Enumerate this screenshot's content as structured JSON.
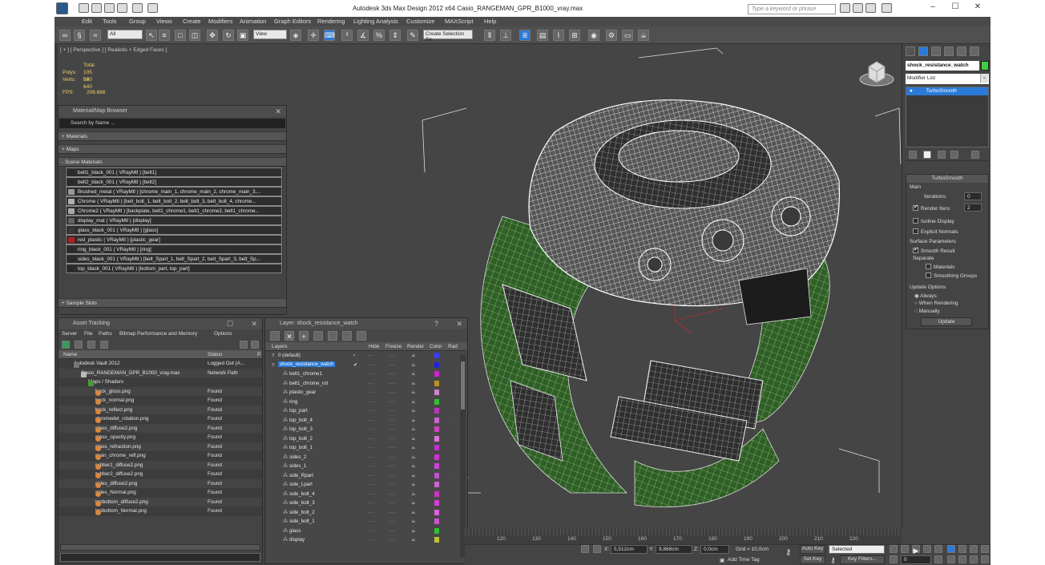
{
  "window": {
    "title": "Autodesk 3ds Max Design 2012 x64     Casio_RANGEMAN_GPR_B1000_vray.max",
    "search_placeholder": "Type a keyword or phrase",
    "min": "–",
    "max": "☐",
    "close": "✕"
  },
  "menu": [
    "Edit",
    "Tools",
    "Group",
    "Views",
    "Create",
    "Modifiers",
    "Animation",
    "Graph Editors",
    "Rendering",
    "Lighting Analysis",
    "Customize",
    "MAXScript",
    "Help"
  ],
  "toolbar": {
    "selection_filter": "All",
    "ref_coord": "View",
    "selection_set": "Create Selection Se"
  },
  "viewport": {
    "label": "[ + ] [ Perspective ] [ Realistic + Edged Faces ]",
    "stats_total": "Total",
    "polys_label": "Polys:",
    "polys": "105 040",
    "verts_label": "Verts:",
    "verts": "53 640",
    "fps_label": "FPS:",
    "fps": "206.686"
  },
  "material_browser": {
    "title": "Material/Map Browser",
    "search": "Search by Name ...",
    "sections": {
      "materials": "+ Materials",
      "maps": "+ Maps",
      "scene": "- Scene Materials",
      "samples": "+ Sample Slots"
    },
    "items": [
      {
        "label": "belt1_black_001  ( VRayMtl )  [belt1]",
        "color": "#2a2a2a"
      },
      {
        "label": "belt2_black_001  ( VRayMtl )  [belt2]",
        "color": "#2a2a2a"
      },
      {
        "label": "Brushed_metal  ( VRayMtl )  [chrome_main_1, chrome_main_2, chrome_main_3,...",
        "color": "#9a9a9a"
      },
      {
        "label": "Chrome  ( VRayMtl )  [belt_bolt_1, belt_bolt_2, belt_bolt_3, belt_bolt_4, chrome...",
        "color": "#b0b0b0"
      },
      {
        "label": "Chrome2  ( VRayMtl )  [backplate, belt1_chrome1, belt1_chrome2, belt1_chrome...",
        "color": "#a8a8a8"
      },
      {
        "label": "display_mat  ( VRayMtl )  [display]",
        "color": "#606060"
      },
      {
        "label": "glass_black_001  ( VRayMtl )  [glass]",
        "color": "#3a3a3a"
      },
      {
        "label": "red_plastic  ( VRayMtl )  [plastic_gear]",
        "color": "#b02020"
      },
      {
        "label": "ring_black_001  ( VRayMtl )  [ring]",
        "color": "#2a2a2a"
      },
      {
        "label": "sides_black_001  ( VRayMtl )  [belt_Spart_1, belt_Spart_2, belt_Spart_3, belt_Sp...",
        "color": "#2a2a2a"
      },
      {
        "label": "top_black_001  ( VRayMtl )  [bottom_part, top_part]",
        "color": "#2a2a2a"
      }
    ]
  },
  "asset_tracking": {
    "title": "Asset Tracking",
    "menu": [
      "Server",
      "File",
      "Paths",
      "Bitmap Performance and Memory",
      "Options"
    ],
    "col_name": "Name",
    "col_status": "Status",
    "col_p": "P",
    "rows": [
      {
        "name": "Autodesk Vault 2012",
        "status": "Logged Out (A...",
        "indent": 1,
        "kind": "vault"
      },
      {
        "name": "Casio_RANGEMAN_GPR_B1000_vray.max",
        "status": "Network Path",
        "indent": 2,
        "kind": "file"
      },
      {
        "name": "Maps / Shaders",
        "status": "",
        "indent": 3,
        "kind": "folder"
      },
      {
        "name": "back_gloss.png",
        "status": "Found",
        "indent": 4,
        "kind": "map"
      },
      {
        "name": "back_normal.png",
        "status": "Found",
        "indent": 4,
        "kind": "map"
      },
      {
        "name": "back_reflect.png",
        "status": "Found",
        "indent": 4,
        "kind": "map"
      },
      {
        "name": "chromedet_rotation.png",
        "status": "Found",
        "indent": 4,
        "kind": "map"
      },
      {
        "name": "glass_diffuse2.png",
        "status": "Found",
        "indent": 4,
        "kind": "map"
      },
      {
        "name": "glass_opacity.png",
        "status": "Found",
        "indent": 4,
        "kind": "map"
      },
      {
        "name": "glass_refraction.png",
        "status": "Found",
        "indent": 4,
        "kind": "map"
      },
      {
        "name": "main_chrome_refl.png",
        "status": "Found",
        "indent": 4,
        "kind": "map"
      },
      {
        "name": "rubber1_diffuse2.png",
        "status": "Found",
        "indent": 4,
        "kind": "map"
      },
      {
        "name": "rubber2_diffuse2.png",
        "status": "Found",
        "indent": 4,
        "kind": "map"
      },
      {
        "name": "sides_diffuse2.png",
        "status": "Found",
        "indent": 4,
        "kind": "map"
      },
      {
        "name": "sides_Normal.png",
        "status": "Found",
        "indent": 4,
        "kind": "map"
      },
      {
        "name": "topbottom_diffuse2.png",
        "status": "Found",
        "indent": 4,
        "kind": "map"
      },
      {
        "name": "topbottom_Normal.png",
        "status": "Found",
        "indent": 4,
        "kind": "map"
      }
    ]
  },
  "layer_dialog": {
    "title": "Layer: shock_resistance_watch",
    "help": "?",
    "cols": {
      "layers": "Layers",
      "hide": "Hide",
      "freeze": "Freeze",
      "render": "Render",
      "color": "Color",
      "rad": "Rad"
    },
    "rows": [
      {
        "name": "0 (default)",
        "indent": 0,
        "color": "#3c3cff",
        "selected": false
      },
      {
        "name": "shock_resistance_watch",
        "indent": 0,
        "color": "#2222dd",
        "selected": true
      },
      {
        "name": "belt1_chrome1",
        "indent": 1,
        "color": "#d020d0",
        "selected": false
      },
      {
        "name": "belt1_chrome_rot",
        "indent": 1,
        "color": "#c09020",
        "selected": false
      },
      {
        "name": "plastic_gear",
        "indent": 1,
        "color": "#d080d0",
        "selected": false
      },
      {
        "name": "ring",
        "indent": 1,
        "color": "#30c030",
        "selected": false
      },
      {
        "name": "top_part",
        "indent": 1,
        "color": "#c030c0",
        "selected": false
      },
      {
        "name": "top_bolt_4",
        "indent": 1,
        "color": "#d060d0",
        "selected": false
      },
      {
        "name": "top_bolt_3",
        "indent": 1,
        "color": "#d040c0",
        "selected": false
      },
      {
        "name": "top_bolt_2",
        "indent": 1,
        "color": "#e070e0",
        "selected": false
      },
      {
        "name": "top_bolt_1",
        "indent": 1,
        "color": "#c030d0",
        "selected": false
      },
      {
        "name": "sides_2",
        "indent": 1,
        "color": "#d030d0",
        "selected": false
      },
      {
        "name": "sides_1",
        "indent": 1,
        "color": "#d040e0",
        "selected": false
      },
      {
        "name": "side_Rpart",
        "indent": 1,
        "color": "#c050d0",
        "selected": false
      },
      {
        "name": "side_Lpart",
        "indent": 1,
        "color": "#d060d0",
        "selected": false
      },
      {
        "name": "side_bolt_4",
        "indent": 1,
        "color": "#d030c0",
        "selected": false
      },
      {
        "name": "side_bolt_3",
        "indent": 1,
        "color": "#d040d0",
        "selected": false
      },
      {
        "name": "side_bolt_2",
        "indent": 1,
        "color": "#e060e0",
        "selected": false
      },
      {
        "name": "side_bolt_1",
        "indent": 1,
        "color": "#d050d0",
        "selected": false
      },
      {
        "name": "glass",
        "indent": 1,
        "color": "#30c030",
        "selected": false
      },
      {
        "name": "display",
        "indent": 1,
        "color": "#c0c030",
        "selected": false
      }
    ]
  },
  "command_panel": {
    "object_name": "shock_resistance_watch",
    "modifier_list": "Modifier List",
    "stack_item": "TurboSmooth",
    "rollout_title": "TurboSmooth",
    "main": "Main",
    "iterations_label": "Iterations:",
    "iterations": "0",
    "render_iters_label": "Render Iters:",
    "render_iters": "2",
    "isoline": "Isoline Display",
    "explicit_normals": "Explicit Normals",
    "surface_params": "Surface Parameters",
    "smooth_result": "Smooth Result",
    "separate": "Separate",
    "materials": "Materials",
    "smoothing_groups": "Smoothing Groups",
    "update_options": "Update Options",
    "always": "Always",
    "when_rendering": "When Rendering",
    "manually": "Manually",
    "update_btn": "Update"
  },
  "timeline": {
    "ticks": [
      "120",
      "130",
      "140",
      "150",
      "160",
      "170",
      "180",
      "190",
      "200",
      "210",
      "220"
    ]
  },
  "status": {
    "x_label": "X:",
    "x": "5,512cm",
    "y_label": "Y:",
    "y": "9,868cm",
    "z_label": "Z:",
    "z": "0,0cm",
    "grid": "Grid = 10,0cm",
    "add_time_tag": "Add Time Tag",
    "auto_key": "Auto Key",
    "selected": "Selected",
    "set_key": "Set Key",
    "key_filters": "Key Filters...",
    "frame": "0"
  }
}
